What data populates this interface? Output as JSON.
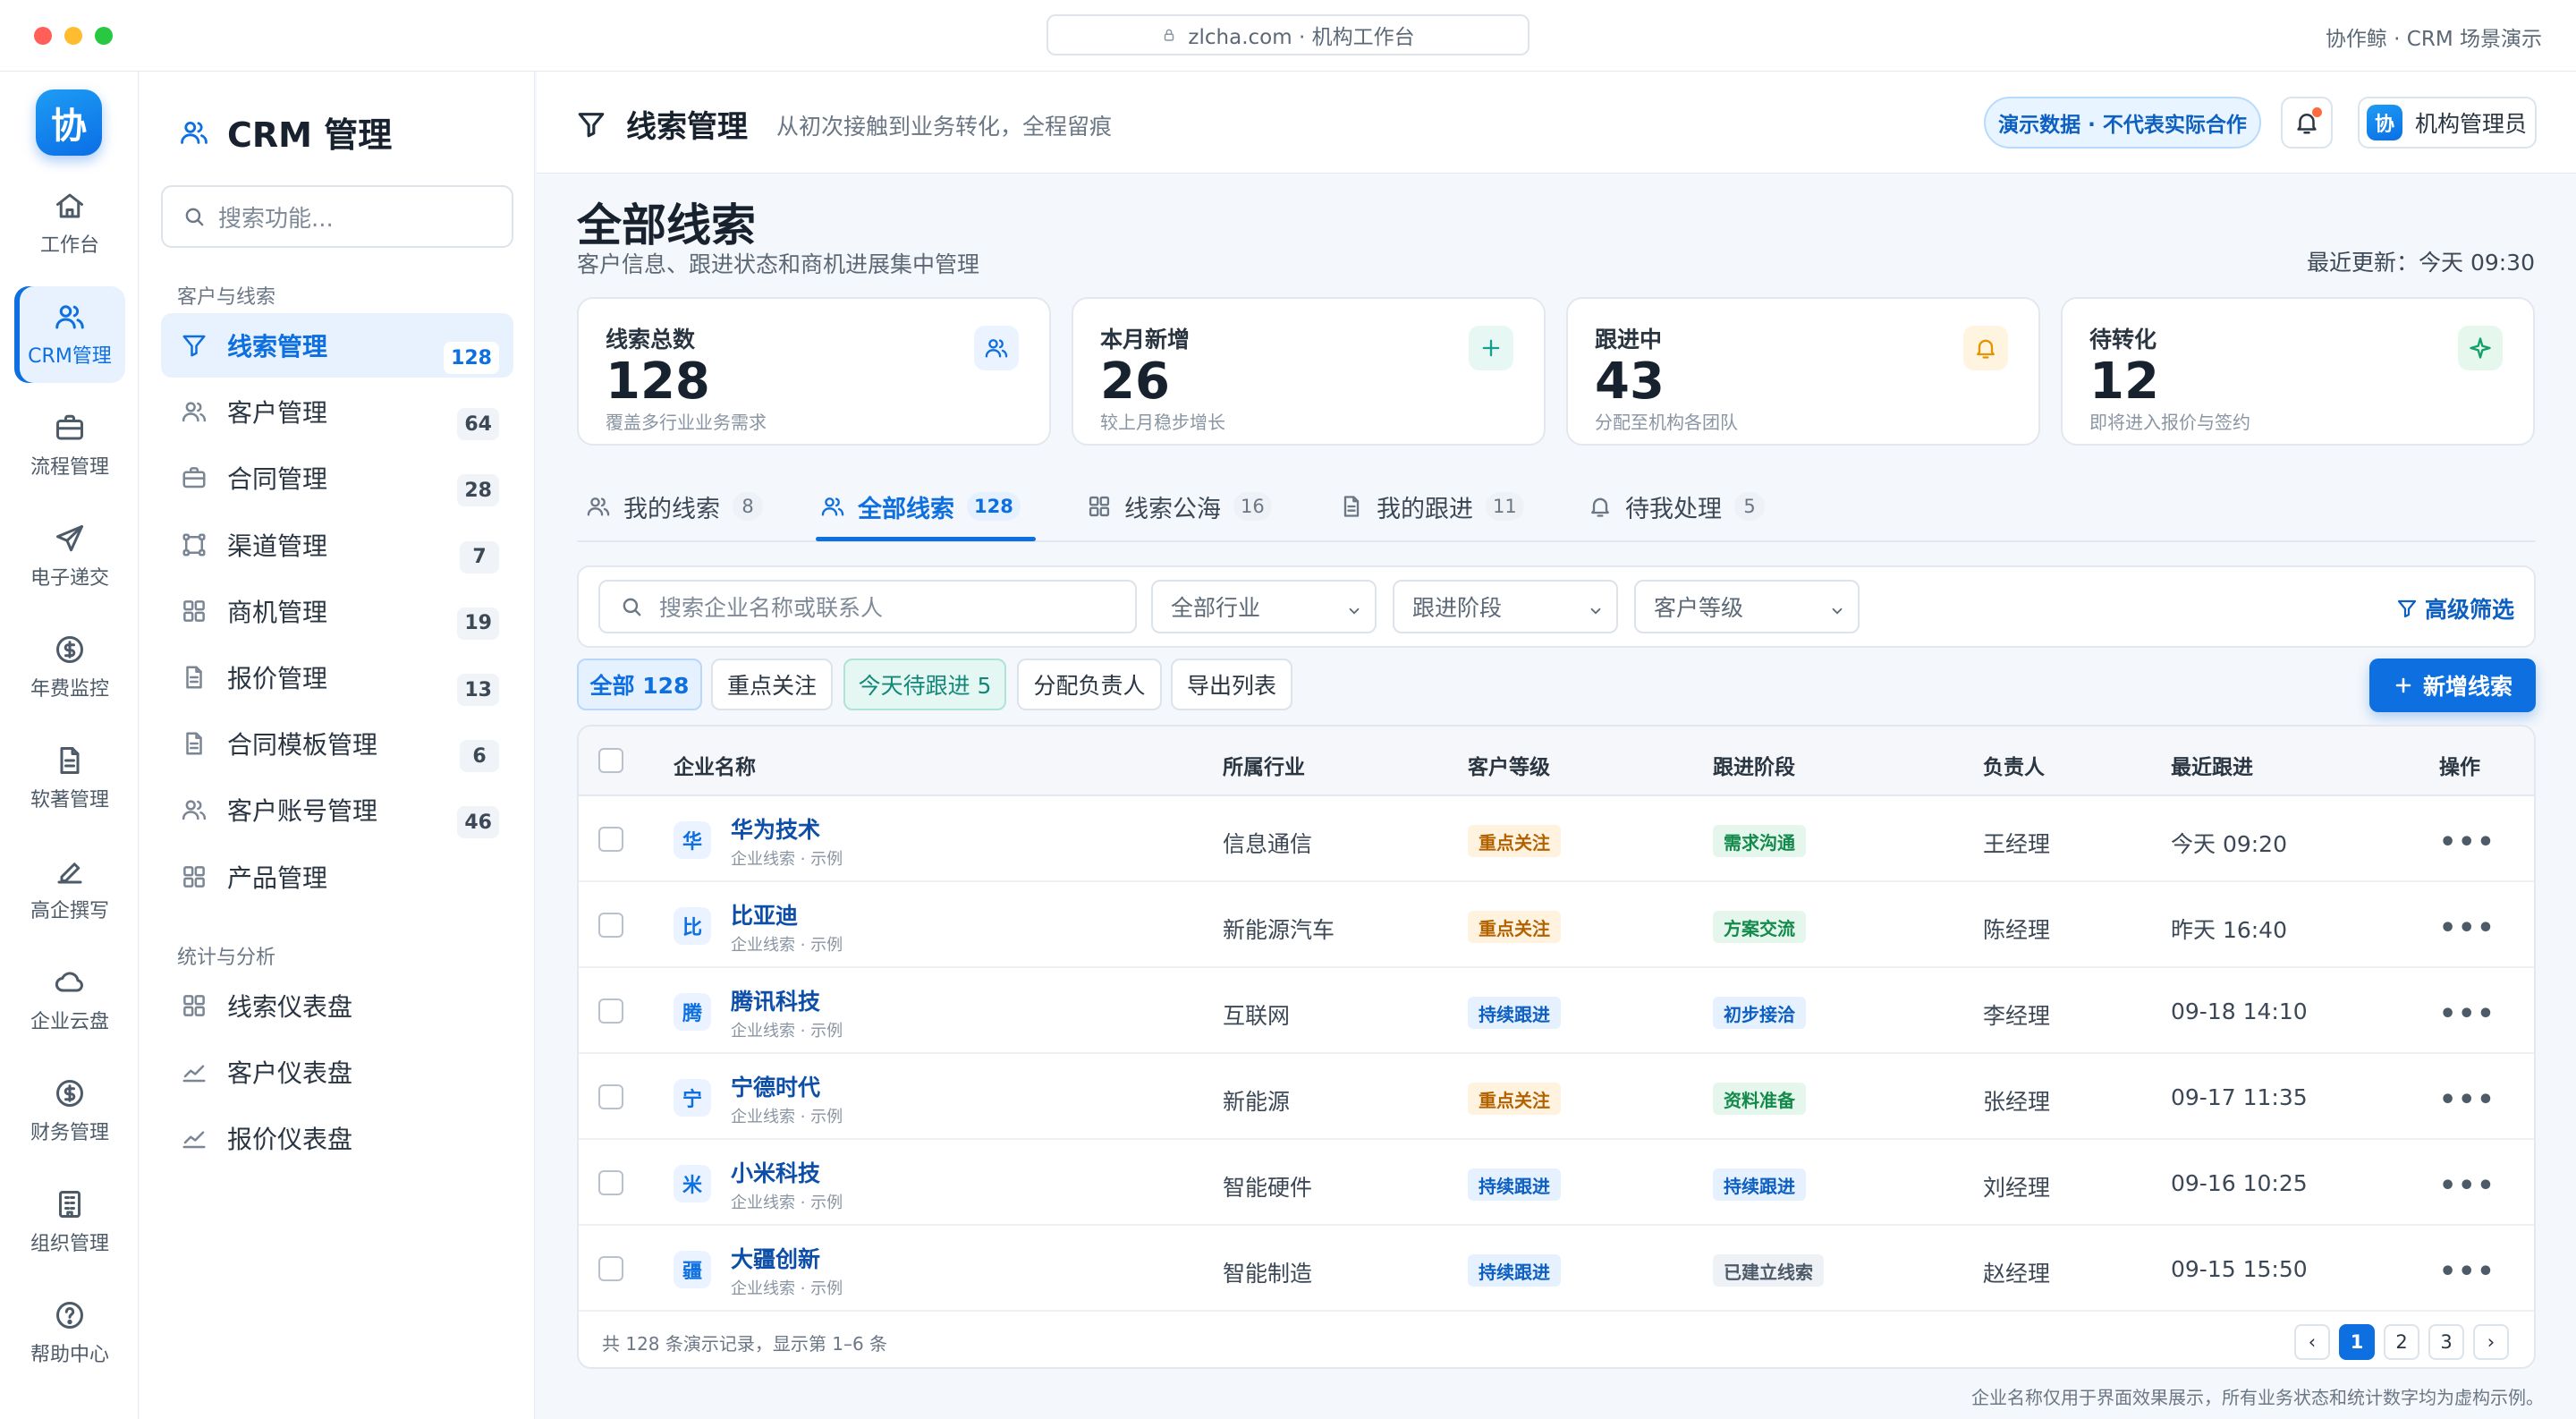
{
  "window": {
    "url": "zlcha.com · 机构工作台",
    "title": "协作鲸 · CRM 场景演示",
    "traffic_colors": [
      "#ff5f57",
      "#febc2e",
      "#28c840"
    ]
  },
  "rail": {
    "logo": "协",
    "items": [
      {
        "label": "工作台",
        "icon": "home-icon"
      },
      {
        "label": "CRM管理",
        "icon": "users-icon",
        "active": true
      },
      {
        "label": "流程管理",
        "icon": "briefcase-icon"
      },
      {
        "label": "电子递交",
        "icon": "send-icon"
      },
      {
        "label": "年费监控",
        "icon": "dollar-icon"
      },
      {
        "label": "软著管理",
        "icon": "document-icon"
      },
      {
        "label": "高企撰写",
        "icon": "pen-icon"
      },
      {
        "label": "企业云盘",
        "icon": "cloud-icon"
      },
      {
        "label": "财务管理",
        "icon": "dollar-icon"
      },
      {
        "label": "组织管理",
        "icon": "building-icon"
      },
      {
        "label": "帮助中心",
        "icon": "help-icon"
      }
    ]
  },
  "sidebar": {
    "title": "CRM 管理",
    "search_placeholder": "搜索功能...",
    "groups": [
      {
        "label": "客户与线索",
        "items": [
          {
            "label": "线索管理",
            "count": "128",
            "icon": "filter-icon",
            "active": true
          },
          {
            "label": "客户管理",
            "count": "64",
            "icon": "users-icon"
          },
          {
            "label": "合同管理",
            "count": "28",
            "icon": "briefcase-icon"
          },
          {
            "label": "渠道管理",
            "count": "7",
            "icon": "channel-icon"
          },
          {
            "label": "商机管理",
            "count": "19",
            "icon": "grid-icon"
          },
          {
            "label": "报价管理",
            "count": "13",
            "icon": "document-icon"
          },
          {
            "label": "合同模板管理",
            "count": "6",
            "icon": "document-icon"
          },
          {
            "label": "客户账号管理",
            "count": "46",
            "icon": "users-icon"
          },
          {
            "label": "产品管理",
            "count": "",
            "icon": "grid-icon"
          }
        ]
      },
      {
        "label": "统计与分析",
        "items": [
          {
            "label": "线索仪表盘",
            "icon": "grid-icon"
          },
          {
            "label": "客户仪表盘",
            "icon": "chart-icon"
          },
          {
            "label": "报价仪表盘",
            "icon": "chart-icon"
          }
        ]
      }
    ]
  },
  "header": {
    "title": "线索管理",
    "subtitle": "从初次接触到业务转化，全程留痕",
    "demo_label": "演示数据 · 不代表实际合作",
    "admin_avatar": "协",
    "admin_label": "机构管理员"
  },
  "page": {
    "title": "全部线索",
    "subtitle": "客户信息、跟进状态和商机进展集中管理",
    "updated": "最近更新：今天 09:30"
  },
  "stats": [
    {
      "label": "线索总数",
      "value": "128",
      "desc": "覆盖多行业业务需求",
      "icon": "users-icon",
      "color": "#0d6fe0",
      "bg": "#eaf3ff"
    },
    {
      "label": "本月新增",
      "value": "26",
      "desc": "较上月稳步增长",
      "icon": "plus-icon",
      "color": "#13a08e",
      "bg": "#e7f7f4"
    },
    {
      "label": "跟进中",
      "value": "43",
      "desc": "分配至机构各团队",
      "icon": "bell-icon",
      "color": "#e39400",
      "bg": "#fff4df"
    },
    {
      "label": "待转化",
      "value": "12",
      "desc": "即将进入报价与签约",
      "icon": "sparkle-icon",
      "color": "#13a06a",
      "bg": "#e6f7ee"
    }
  ],
  "tabs": [
    {
      "label": "我的线索",
      "count": "8",
      "icon": "users-icon"
    },
    {
      "label": "全部线索",
      "count": "128",
      "icon": "users-icon",
      "active": true
    },
    {
      "label": "线索公海",
      "count": "16",
      "icon": "grid-icon"
    },
    {
      "label": "我的跟进",
      "count": "11",
      "icon": "document-icon"
    },
    {
      "label": "待我处理",
      "count": "5",
      "icon": "bell-icon"
    }
  ],
  "filters": {
    "search_placeholder": "搜索企业名称或联系人",
    "industry": "全部行业",
    "stage": "跟进阶段",
    "level": "客户等级",
    "advanced": "高级筛选"
  },
  "chips": [
    "全部 128",
    "重点关注",
    "今天待跟进 5",
    "分配负责人",
    "导出列表"
  ],
  "add_button": "新增线索",
  "table": {
    "columns": [
      "企业名称",
      "所属行业",
      "客户等级",
      "跟进阶段",
      "负责人",
      "最近跟进",
      "操作"
    ],
    "rows": [
      {
        "avatar": "华",
        "name": "华为技术",
        "tag": "企业线索 · 示例",
        "industry": "信息通信",
        "level": "重点关注",
        "level_kind": "key",
        "stage": "需求沟通",
        "stage_kind": "green",
        "owner": "王经理",
        "last": "今天 09:20"
      },
      {
        "avatar": "比",
        "name": "比亚迪",
        "tag": "企业线索 · 示例",
        "industry": "新能源汽车",
        "level": "重点关注",
        "level_kind": "key",
        "stage": "方案交流",
        "stage_kind": "green",
        "owner": "陈经理",
        "last": "昨天 16:40"
      },
      {
        "avatar": "腾",
        "name": "腾讯科技",
        "tag": "企业线索 · 示例",
        "industry": "互联网",
        "level": "持续跟进",
        "level_kind": "cont",
        "stage": "初步接洽",
        "stage_kind": "blue",
        "owner": "李经理",
        "last": "09-18 14:10"
      },
      {
        "avatar": "宁",
        "name": "宁德时代",
        "tag": "企业线索 · 示例",
        "industry": "新能源",
        "level": "重点关注",
        "level_kind": "key",
        "stage": "资料准备",
        "stage_kind": "green",
        "owner": "张经理",
        "last": "09-17 11:35"
      },
      {
        "avatar": "米",
        "name": "小米科技",
        "tag": "企业线索 · 示例",
        "industry": "智能硬件",
        "level": "持续跟进",
        "level_kind": "cont",
        "stage": "持续跟进",
        "stage_kind": "blue",
        "owner": "刘经理",
        "last": "09-16 10:25"
      },
      {
        "avatar": "疆",
        "name": "大疆创新",
        "tag": "企业线索 · 示例",
        "industry": "智能制造",
        "level": "持续跟进",
        "level_kind": "cont",
        "stage": "已建立线索",
        "stage_kind": "gray",
        "owner": "赵经理",
        "last": "09-15 15:50"
      }
    ],
    "action_label": "•••",
    "footer": "共 128 条演示记录，显示第 1–6 条",
    "pages": [
      "‹",
      "1",
      "2",
      "3",
      "›"
    ],
    "current_page": "1"
  },
  "disclaimer": "企业名称仅用于界面效果展示，所有业务状态和统计数字均为虚构示例。"
}
